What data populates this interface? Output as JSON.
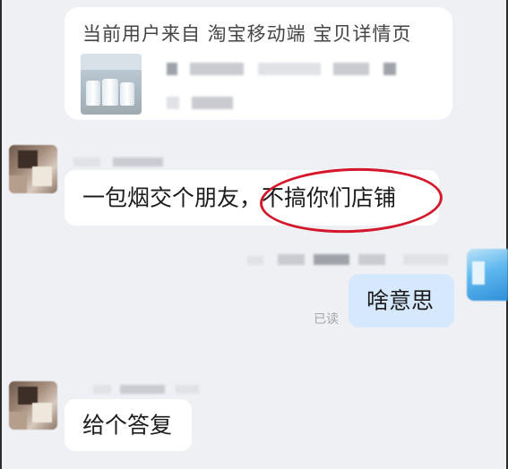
{
  "product_card": {
    "source_text": "当前用户来自 淘宝移动端 宝贝详情页",
    "thumbnail_icon": "product-photo"
  },
  "messages": [
    {
      "sender": "other",
      "text": "一包烟交个朋友，不搞你们店铺",
      "highlight": "不搞你们店铺"
    },
    {
      "sender": "self",
      "text": "啥意思",
      "status": "已读"
    },
    {
      "sender": "other",
      "text": "给个答复"
    }
  ],
  "colors": {
    "background": "#eff0f4",
    "bubble_other": "#ffffff",
    "bubble_self": "#d6e8fd",
    "highlight_ring": "#d4172b",
    "read_status": "#a4a6aa"
  }
}
